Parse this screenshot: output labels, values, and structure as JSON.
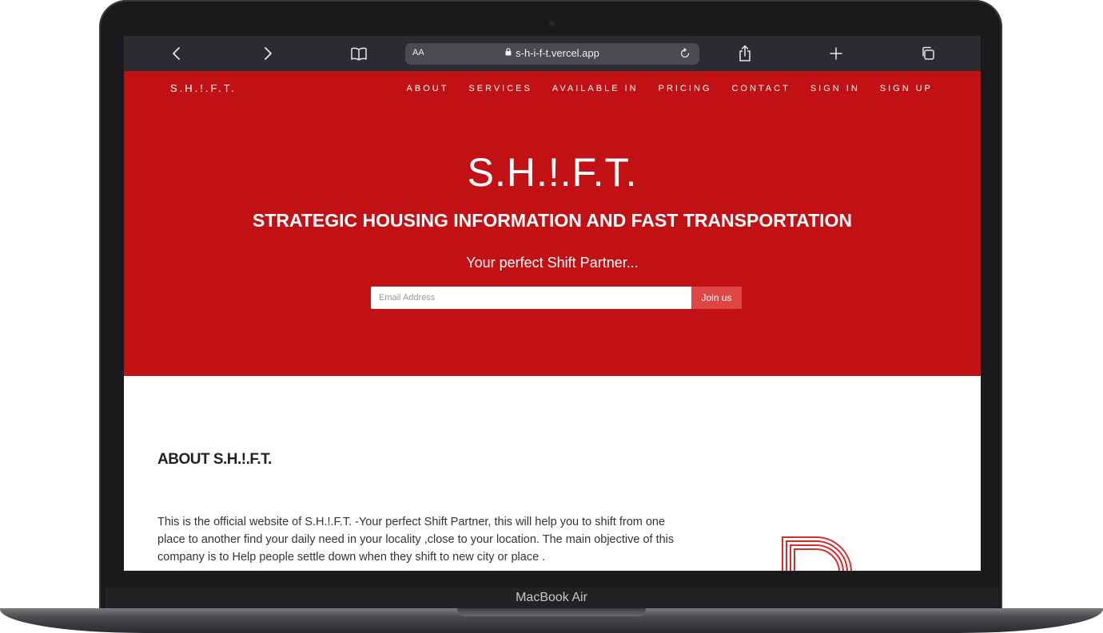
{
  "device": {
    "model_label": "MacBook Air"
  },
  "browser": {
    "text_size_label": "AA",
    "url": "s-h-i-f-t.vercel.app",
    "icons": {
      "back": "chevron-left-icon",
      "forward": "chevron-right-icon",
      "bookmarks": "book-icon",
      "lock": "lock-icon",
      "reload": "reload-icon",
      "share": "share-icon",
      "new_tab": "plus-icon",
      "tabs": "tabs-icon"
    }
  },
  "site": {
    "brand": "S.H.!.F.T.",
    "nav": [
      "ABOUT",
      "SERVICES",
      "AVAILABLE IN",
      "PRICING",
      "CONTACT",
      "SIGN IN",
      "SIGN UP"
    ],
    "hero": {
      "title": "S.H.!.F.T.",
      "subtitle": "STRATEGIC HOUSING INFORMATION AND FAST TRANSPORTATION",
      "tagline": "Your perfect Shift Partner...",
      "email_placeholder": "Email Address",
      "email_value": "",
      "join_label": "Join us"
    },
    "about": {
      "title": "ABOUT S.H.!.F.T.",
      "text": "This is the official website of S.H.!.F.T. -Your perfect Shift Partner, this will help you to shift from one place to another find your daily need in your locality ,close to your location. The main objective of this company is to Help people settle down when they shift to new city or place ."
    }
  },
  "colors": {
    "primary_red": "#c21114",
    "button_red": "#e04545",
    "toolbar": "#2b2c2f"
  }
}
